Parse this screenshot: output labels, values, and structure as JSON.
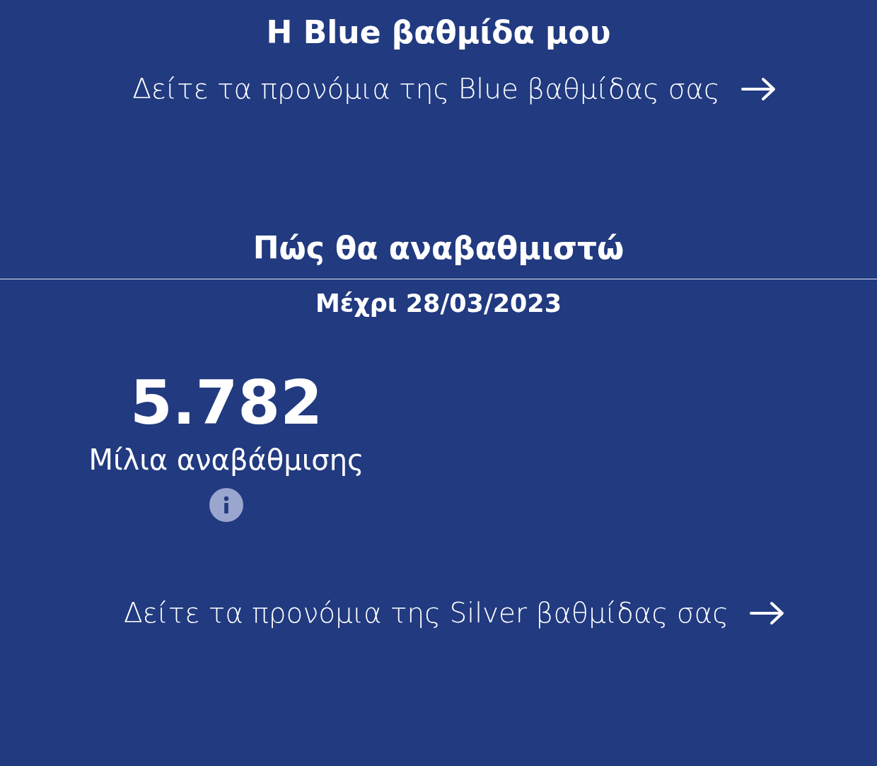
{
  "header": {
    "title": "Η Blue βαθμίδα μου"
  },
  "current_tier_link": {
    "label": "Δείτε τα προνόμια της Blue βαθμίδας σας"
  },
  "upgrade": {
    "title": "Πώς θα αναβαθμιστώ",
    "deadline": "Μέχρι 28/03/2023",
    "miles": "5.782",
    "miles_label": "Μίλια αναβάθμισης"
  },
  "next_tier_link": {
    "label": "Δείτε τα προνόμια της Silver βαθμίδας σας"
  }
}
